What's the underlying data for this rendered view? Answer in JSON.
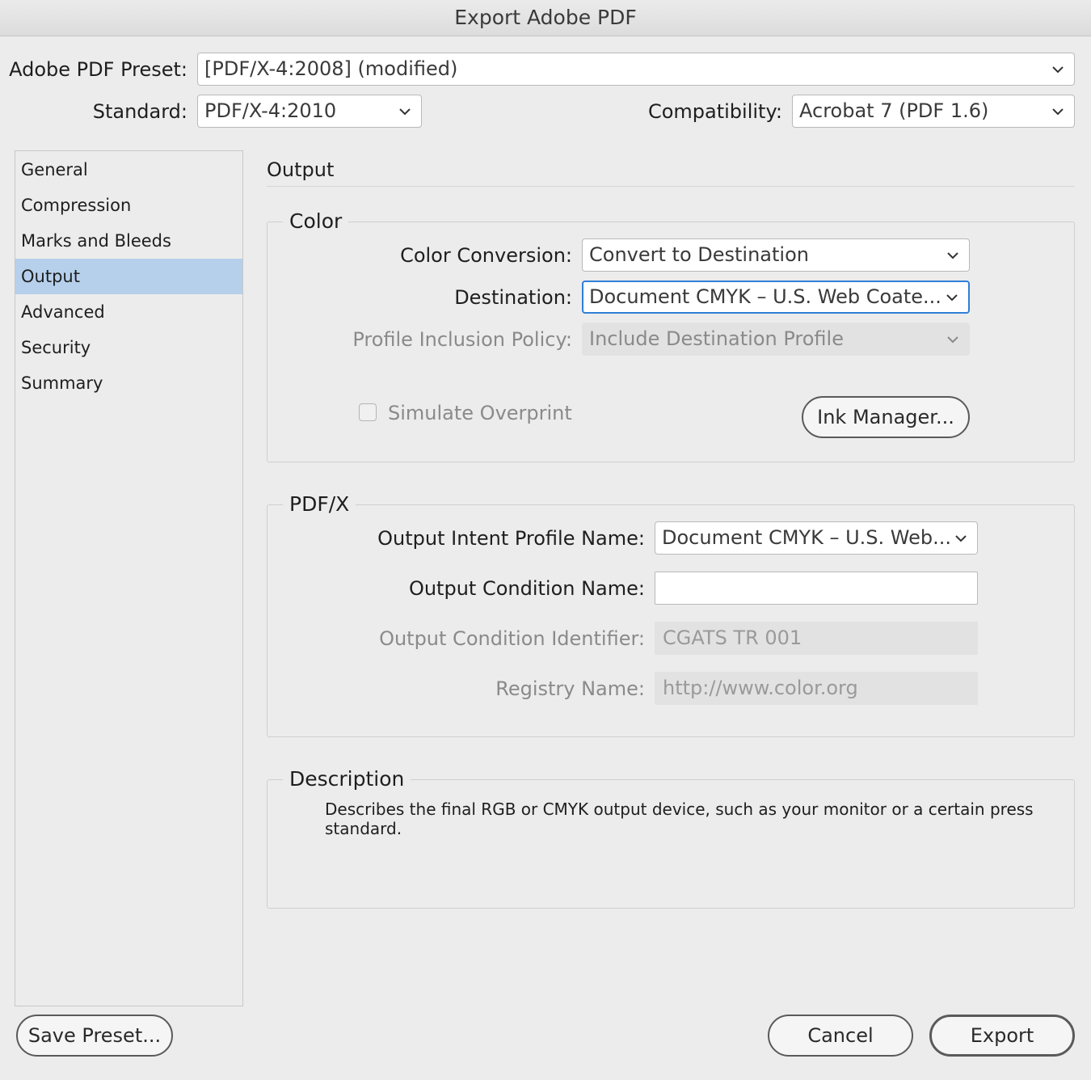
{
  "window": {
    "title": "Export Adobe PDF"
  },
  "preset": {
    "label": "Adobe PDF Preset:",
    "value": "[PDF/X-4:2008] (modified)"
  },
  "standard": {
    "label": "Standard:",
    "value": "PDF/X-4:2010"
  },
  "compatibility": {
    "label": "Compatibility:",
    "value": "Acrobat 7 (PDF 1.6)"
  },
  "sidebar": {
    "items": [
      {
        "label": "General"
      },
      {
        "label": "Compression"
      },
      {
        "label": "Marks and Bleeds"
      },
      {
        "label": "Output",
        "selected": true
      },
      {
        "label": "Advanced"
      },
      {
        "label": "Security"
      },
      {
        "label": "Summary"
      }
    ]
  },
  "main": {
    "section_title": "Output",
    "color": {
      "legend": "Color",
      "conversion_label": "Color Conversion:",
      "conversion_value": "Convert to Destination",
      "destination_label": "Destination:",
      "destination_value": "Document CMYK – U.S. Web Coate...",
      "policy_label": "Profile Inclusion Policy:",
      "policy_value": "Include Destination Profile",
      "simulate_label": "Simulate Overprint",
      "simulate_checked": false,
      "ink_manager_label": "Ink Manager..."
    },
    "pdfx": {
      "legend": "PDF/X",
      "intent_label": "Output Intent Profile Name:",
      "intent_value": "Document CMYK – U.S. Web...",
      "condition_name_label": "Output Condition Name:",
      "condition_name_value": "",
      "condition_id_label": "Output Condition Identifier:",
      "condition_id_value": "CGATS TR 001",
      "registry_label": "Registry Name:",
      "registry_value": "http://www.color.org"
    },
    "description": {
      "legend": "Description",
      "text": "Describes the final RGB or CMYK output device, such as your monitor or a certain press standard."
    }
  },
  "footer": {
    "save_preset_label": "Save Preset...",
    "cancel_label": "Cancel",
    "export_label": "Export"
  },
  "colors": {
    "accent_focus": "#2f7fd6",
    "selection": "#b6d0ec",
    "background": "#ececec"
  }
}
